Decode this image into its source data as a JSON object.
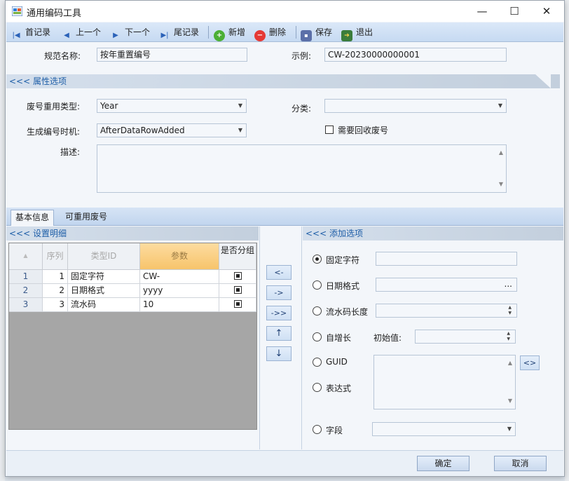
{
  "window": {
    "title": "通用编码工具"
  },
  "titlebar": {
    "minimize": "—",
    "maximize": "☐",
    "close": "✕"
  },
  "toolbar": {
    "first": "首记录",
    "prev": "上一个",
    "next": "下一个",
    "last": "尾记录",
    "add": "新增",
    "delete": "删除",
    "save": "保存",
    "exit": "退出"
  },
  "header": {
    "rule_name_label": "规范名称:",
    "rule_name_value": "按年重置编号",
    "example_label": "示例:",
    "example_value": "CW-20230000000001"
  },
  "props": {
    "section_title": "<<< 属性选项",
    "reuse_type_label": "废号重用类型:",
    "reuse_type_value": "Year",
    "category_label": "分类:",
    "category_value": "",
    "gen_time_label": "生成编号时机:",
    "gen_time_value": "AfterDataRowAdded",
    "recycle_label": "需要回收废号",
    "desc_label": "描述:",
    "desc_value": ""
  },
  "tabs": [
    {
      "label": "基本信息"
    },
    {
      "label": "可重用废号"
    }
  ],
  "details": {
    "section_title": "<<< 设置明细",
    "columns": {
      "seq": "序列",
      "type_id": "类型ID",
      "param": "参数",
      "group": "是否分组"
    },
    "rows": [
      {
        "row": "1",
        "seq": "1",
        "type": "固定字符",
        "param": "CW-"
      },
      {
        "row": "2",
        "seq": "2",
        "type": "日期格式",
        "param": "yyyy"
      },
      {
        "row": "3",
        "seq": "3",
        "type": "流水码",
        "param": "10"
      }
    ]
  },
  "mid_buttons": {
    "left": "<-",
    "right": "->",
    "right_all": "->>",
    "up": "↑",
    "down": "↓"
  },
  "options": {
    "section_title": "<<< 添加选项",
    "fixed_label": "固定字符",
    "fixed_value": "",
    "date_label": "日期格式",
    "date_value": "",
    "ellipsis": "...",
    "serial_label": "流水码长度",
    "serial_value": "",
    "auto_label": "自增长",
    "init_label": "初始值:",
    "init_value": "",
    "guid_label": "GUID",
    "expr_label": "表达式",
    "expr_value": "",
    "expr_button": "<>",
    "field_label": "字段",
    "field_value": ""
  },
  "footer": {
    "ok": "确定",
    "cancel": "取消"
  }
}
